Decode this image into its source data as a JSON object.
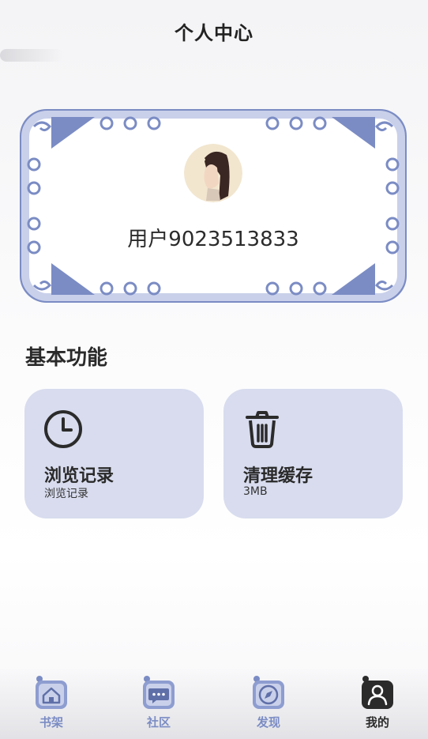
{
  "header": {
    "title": "个人中心"
  },
  "profile": {
    "username": "用户9023513833",
    "avatar_icon": "avatar-portrait-icon"
  },
  "basic_features": {
    "title": "基本功能",
    "items": [
      {
        "label": "浏览记录",
        "sub": "浏览记录",
        "icon": "clock-icon"
      },
      {
        "label": "清理缓存",
        "sub": "3MB",
        "icon": "trash-icon"
      }
    ]
  },
  "tabbar": {
    "items": [
      {
        "label": "书架",
        "icon": "home-icon",
        "active": false
      },
      {
        "label": "社区",
        "icon": "chat-icon",
        "active": false
      },
      {
        "label": "发现",
        "icon": "compass-icon",
        "active": false
      },
      {
        "label": "我的",
        "icon": "user-icon",
        "active": true
      }
    ]
  },
  "colors": {
    "accent": "#7b8cc4",
    "card_bg": "#d8dcee",
    "inactive_tab": "#7b8cc4",
    "active_tab": "#2b2b2b"
  }
}
